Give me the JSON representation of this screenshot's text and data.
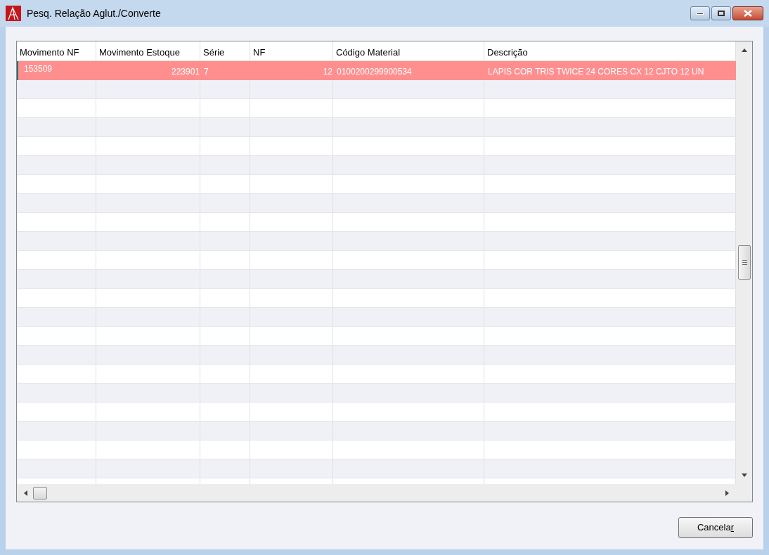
{
  "window": {
    "title": "Pesq. Relação Aglut./Converte"
  },
  "table": {
    "columns": [
      {
        "label": "Movimento NF"
      },
      {
        "label": "Movimento Estoque"
      },
      {
        "label": "Série"
      },
      {
        "label": "NF"
      },
      {
        "label": "Código Material"
      },
      {
        "label": "Descrição"
      }
    ],
    "rows": [
      {
        "selected": true,
        "cells": [
          "153509",
          "223901",
          "7",
          "12",
          "0100200299900534",
          "LAPIS COR TRIS TWICE 24 CORES CX 12 CJTO 12 UN"
        ]
      }
    ]
  },
  "buttons": [
    {
      "label": "Cancelar"
    }
  ]
}
